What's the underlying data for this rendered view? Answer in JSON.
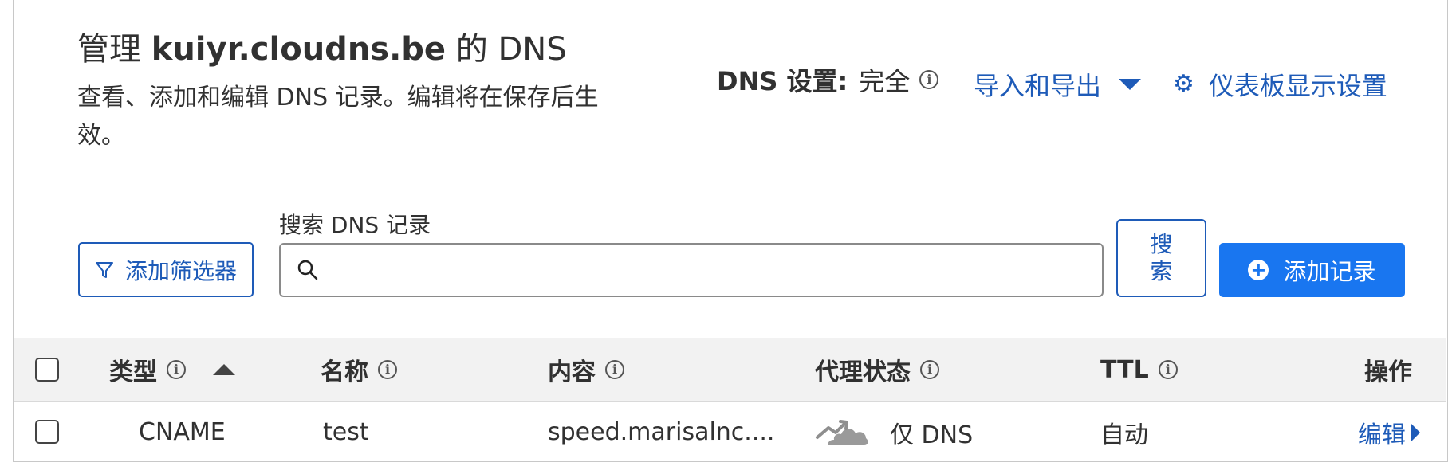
{
  "header": {
    "title_prefix": "管理",
    "domain": "kuiyr.cloudns.be",
    "title_suffix": "的 DNS",
    "description": "查看、添加和编辑 DNS 记录。编辑将在保存后生效。"
  },
  "settings": {
    "dns_label": "DNS 设置:",
    "dns_value": "完全",
    "import_export": "导入和导出",
    "dashboard_display": "仪表板显示设置"
  },
  "toolbar": {
    "add_filter": "添加筛选器",
    "search_label": "搜索 DNS 记录",
    "search_placeholder": "",
    "search_button": "搜索",
    "add_record": "添加记录"
  },
  "table": {
    "columns": {
      "type": "类型",
      "name": "名称",
      "content": "内容",
      "proxy": "代理状态",
      "ttl": "TTL",
      "actions": "操作"
    },
    "rows": [
      {
        "type": "CNAME",
        "name": "test",
        "content": "speed.marisalnc....",
        "proxy": "仅 DNS",
        "ttl": "自动",
        "action": "编辑"
      }
    ]
  },
  "colors": {
    "accent": "#1976f0",
    "link": "#1e5bb8",
    "header_bg": "#f2f2f2"
  }
}
